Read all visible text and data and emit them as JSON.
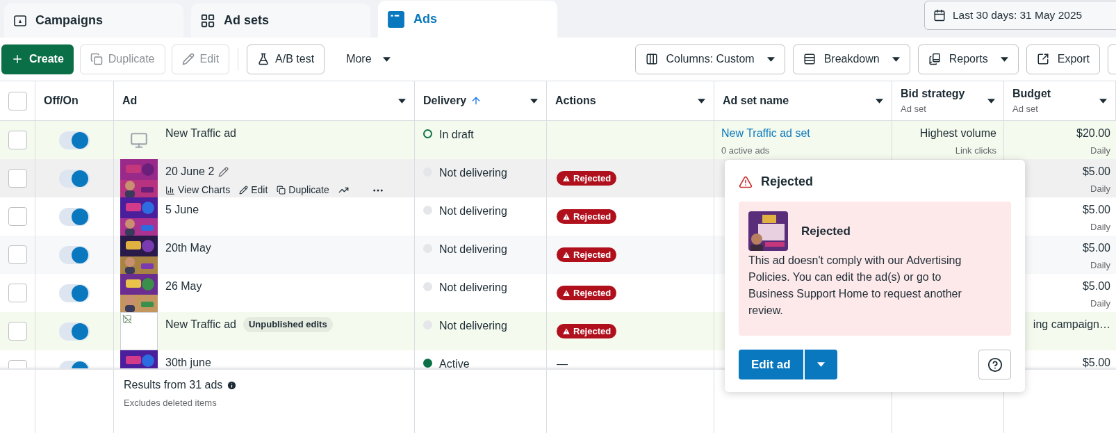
{
  "tabs": [
    {
      "label": "Campaigns",
      "selected": false
    },
    {
      "label": "Ad sets",
      "selected": false
    },
    {
      "label": "Ads",
      "selected": true
    }
  ],
  "date_range": "Last 30 days: 31 May 2025",
  "toolbar": {
    "left": [
      {
        "label": "Create",
        "kind": "primary",
        "disabled": false
      },
      {
        "label": "Duplicate",
        "kind": "normal",
        "disabled": true
      },
      {
        "label": "Edit",
        "kind": "normal",
        "disabled": true
      },
      {
        "label": "A/B test",
        "kind": "normal",
        "disabled": false
      },
      {
        "label": "More",
        "kind": "menu",
        "disabled": false
      }
    ],
    "right": [
      {
        "label": "Columns: Custom"
      },
      {
        "label": "Breakdown"
      },
      {
        "label": "Reports"
      },
      {
        "label": "Export"
      }
    ]
  },
  "table": {
    "select_all": {
      "checked": false
    },
    "columns": [
      {
        "label": "Off/On",
        "menu": false
      },
      {
        "label": "Ad",
        "menu": true
      },
      {
        "label": "Delivery",
        "menu": true,
        "sorted": true
      },
      {
        "label": "Actions",
        "menu": true
      },
      {
        "label": "Ad set name",
        "menu": true
      },
      {
        "label": "Bid strategy",
        "sub": "Ad set",
        "menu": true
      },
      {
        "label": "Budget",
        "sub": "Ad set",
        "menu": true
      }
    ],
    "rows": [
      {
        "kind": "placeholder",
        "hovered": false,
        "checked": false,
        "on": true,
        "name": "New Traffic ad",
        "delivery": {
          "kind": "draft",
          "label": "In draft"
        },
        "action": {
          "kind": "none"
        },
        "ad_set": "New Traffic ad set",
        "ad_set_sub": "0 active ads",
        "bid": "Highest volume",
        "bid_sub": "Link clicks",
        "budget": "$20.00",
        "budget_sub": "Daily"
      },
      {
        "kind": "picture",
        "hovered": true,
        "checked": false,
        "on": true,
        "name": "20 June 2",
        "hover_actions": [
          "View Charts",
          "Edit",
          "Duplicate"
        ],
        "delivery": {
          "kind": "off",
          "label": "Not delivering"
        },
        "action": {
          "kind": "badge",
          "label": "Rejected"
        },
        "budget": "$5.00",
        "budget_sub": "Daily"
      },
      {
        "kind": "picture",
        "hovered": false,
        "checked": false,
        "on": true,
        "name": "5 June",
        "delivery": {
          "kind": "off",
          "label": "Not delivering"
        },
        "action": {
          "kind": "badge",
          "label": "Rejected"
        },
        "budget": "$5.00",
        "budget_sub": "Daily"
      },
      {
        "kind": "picture",
        "hovered": false,
        "checked": false,
        "on": true,
        "name": "20th May",
        "delivery": {
          "kind": "off",
          "label": "Not delivering"
        },
        "action": {
          "kind": "badge",
          "label": "Rejected"
        },
        "budget": "$5.00",
        "budget_sub": "Daily"
      },
      {
        "kind": "picture",
        "hovered": false,
        "checked": false,
        "on": true,
        "name": "26 May",
        "delivery": {
          "kind": "off",
          "label": "Not delivering"
        },
        "action": {
          "kind": "badge",
          "label": "Rejected"
        },
        "budget": "$5.00",
        "budget_sub": "Daily"
      },
      {
        "kind": "broken",
        "hovered": false,
        "checked": false,
        "on": true,
        "name": "New Traffic ad",
        "tag": "Unpublished edits",
        "delivery": {
          "kind": "off",
          "label": "Not delivering"
        },
        "action": {
          "kind": "badge",
          "label": "Rejected"
        },
        "budget": "ing campaign…"
      },
      {
        "kind": "picture",
        "hovered": false,
        "checked": false,
        "on": true,
        "name": "30th june",
        "delivery": {
          "kind": "active",
          "label": "Active"
        },
        "action": {
          "kind": "dash",
          "label": "—"
        },
        "budget": "$5.00"
      }
    ],
    "footer": {
      "title": "Results from 31 ads",
      "note": "Excludes deleted items"
    }
  },
  "popup": {
    "title": "Rejected",
    "card_title": "Rejected",
    "card_text": "This ad doesn't comply with our Advertising Policies. You can edit the ad(s) or go to Business Support Home to request another review.",
    "button": "Edit ad"
  }
}
